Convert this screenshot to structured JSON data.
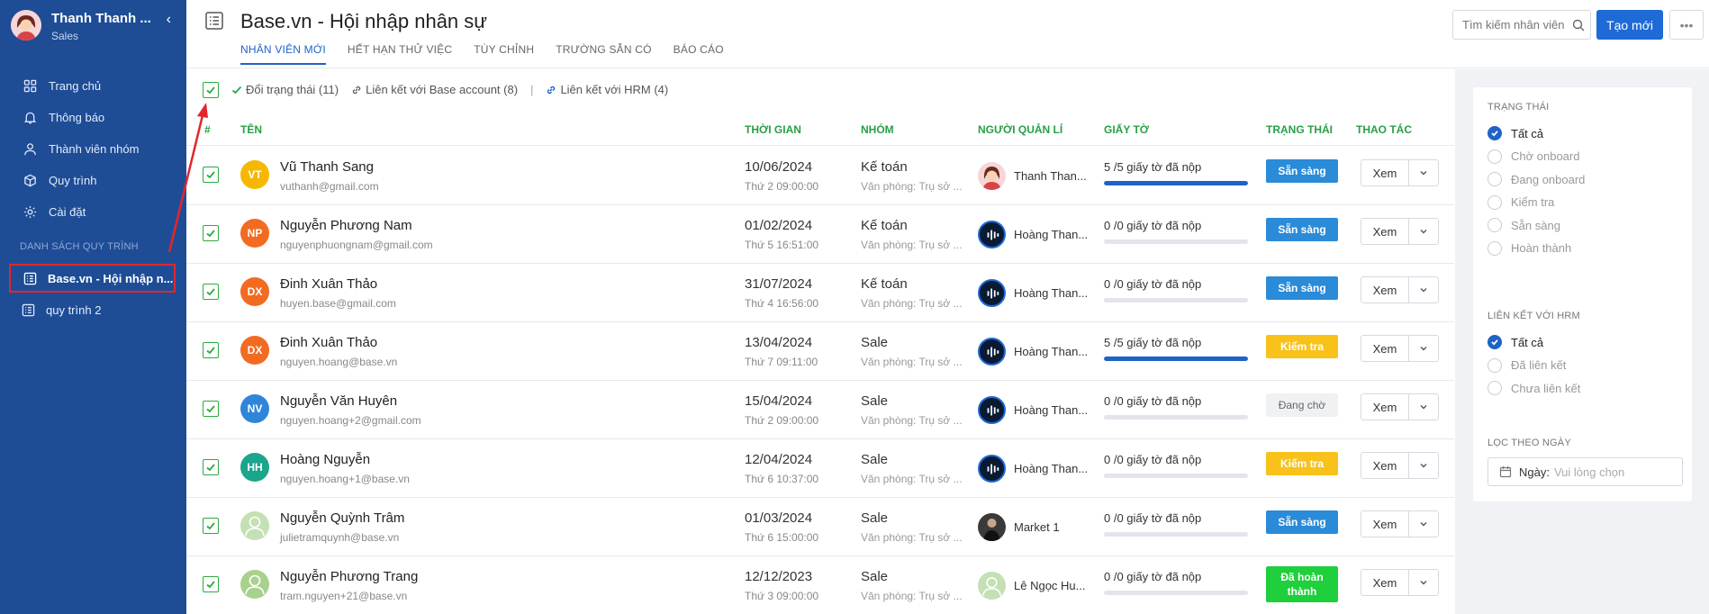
{
  "user": {
    "name": "Thanh Thanh ...",
    "role": "Sales"
  },
  "nav": [
    {
      "label": "Trang chủ",
      "icon": "grid-icon"
    },
    {
      "label": "Thông báo",
      "icon": "bell-icon"
    },
    {
      "label": "Thành viên nhóm",
      "icon": "user-icon"
    },
    {
      "label": "Quy trình",
      "icon": "box-icon"
    },
    {
      "label": "Cài đặt",
      "icon": "gear-icon"
    }
  ],
  "process_section": "DANH SÁCH QUY TRÌNH",
  "processes": [
    "Base.vn - Hội nhập n...",
    "quy trình 2"
  ],
  "header": {
    "title": "Base.vn - Hội nhập nhân sự",
    "tabs": [
      "NHÂN VIÊN MỚI",
      "HẾT HẠN THỬ VIỆC",
      "TÙY CHỈNH",
      "TRƯỜNG SẴN CÓ",
      "BÁO CÁO"
    ],
    "search_placeholder": "Tìm kiếm nhân viên",
    "new_label": "Tạo mới",
    "more_label": "•••"
  },
  "toolbar": {
    "change_status": "Đổi trạng thái (11)",
    "link_base": "Liên kết với Base account (8)",
    "sep": "|",
    "link_hrm": "Liên kết với HRM (4)"
  },
  "columns": {
    "index": "#",
    "name": "TÊN",
    "time": "THỜI GIAN",
    "group": "NHÓM",
    "manager": "NGƯỜI QUẢN LÍ",
    "docs": "GIẤY TỜ",
    "status": "TRẠNG THÁI",
    "action": "THAO TÁC"
  },
  "rows": [
    {
      "initials": "VT",
      "color": "#f5b800",
      "name": "Vũ Thanh Sang",
      "email": "vuthanh@gmail.com",
      "date": "10/06/2024",
      "time": "Thứ 2 09:00:00",
      "group": "Kế toán",
      "office": "Văn phòng: Trụ sở ...",
      "manager": "Thanh Than...",
      "manager_avatar": "woman",
      "docs": "5 /5 giấy tờ đã nộp",
      "progress": 1.0,
      "status": "Sẵn sàng",
      "status_type": "ready",
      "view": "Xem"
    },
    {
      "initials": "NP",
      "color": "#f26b21",
      "name": "Nguyễn Phương Nam",
      "email": "nguyenphuongnam@gmail.com",
      "date": "01/02/2024",
      "time": "Thứ 5 16:51:00",
      "group": "Kế toán",
      "office": "Văn phòng: Trụ sở ...",
      "manager": "Hoàng Than...",
      "manager_avatar": "wave",
      "docs": "0 /0 giấy tờ đã nộp",
      "progress": 0,
      "status": "Sẵn sàng",
      "status_type": "ready",
      "view": "Xem"
    },
    {
      "initials": "DX",
      "color": "#f26b21",
      "name": "Đinh Xuân Thảo",
      "email": "huyen.base@gmail.com",
      "date": "31/07/2024",
      "time": "Thứ 4 16:56:00",
      "group": "Kế toán",
      "office": "Văn phòng: Trụ sở ...",
      "manager": "Hoàng Than...",
      "manager_avatar": "wave",
      "docs": "0 /0 giấy tờ đã nộp",
      "progress": 0,
      "status": "Sẵn sàng",
      "status_type": "ready",
      "view": "Xem"
    },
    {
      "initials": "DX",
      "color": "#f26b21",
      "name": "Đinh Xuân Thảo",
      "email": "nguyen.hoang@base.vn",
      "date": "13/04/2024",
      "time": "Thứ 7 09:11:00",
      "group": "Sale",
      "office": "Văn phòng: Trụ sở ...",
      "manager": "Hoàng Than...",
      "manager_avatar": "wave",
      "docs": "5 /5 giấy tờ đã nộp",
      "progress": 1.0,
      "status": "Kiểm tra",
      "status_type": "check",
      "view": "Xem"
    },
    {
      "initials": "NV",
      "color": "#2f86d8",
      "name": "Nguyễn Văn Huyên",
      "email": "nguyen.hoang+2@gmail.com",
      "date": "15/04/2024",
      "time": "Thứ 2 09:00:00",
      "group": "Sale",
      "office": "Văn phòng: Trụ sở ...",
      "manager": "Hoàng Than...",
      "manager_avatar": "wave",
      "docs": "0 /0 giấy tờ đã nộp",
      "progress": 0,
      "status": "Đang chờ",
      "status_type": "wait",
      "view": "Xem"
    },
    {
      "initials": "HH",
      "color": "#1aa58c",
      "name": "Hoàng Nguyễn",
      "email": "nguyen.hoang+1@base.vn",
      "date": "12/04/2024",
      "time": "Thứ 6 10:37:00",
      "group": "Sale",
      "office": "Văn phòng: Trụ sở ...",
      "manager": "Hoàng Than...",
      "manager_avatar": "wave",
      "docs": "0 /0 giấy tờ đã nộp",
      "progress": 0,
      "status": "Kiểm tra",
      "status_type": "check",
      "view": "Xem"
    },
    {
      "initials": "",
      "color": "#c5e0b4",
      "name": "Nguyễn Quỳnh Trâm",
      "email": "julietramquynh@base.vn",
      "date": "01/03/2024",
      "time": "Thứ 6 15:00:00",
      "group": "Sale",
      "office": "Văn phòng: Trụ sở ...",
      "manager": "Market 1",
      "manager_avatar": "photo",
      "docs": "0 /0 giấy tờ đã nộp",
      "progress": 0,
      "status": "Sẵn sàng",
      "status_type": "ready",
      "view": "Xem"
    },
    {
      "initials": "",
      "color": "#a9d18e",
      "name": "Nguyễn Phương Trang",
      "email": "tram.nguyen+21@base.vn",
      "date": "12/12/2023",
      "time": "Thứ 3 09:00:00",
      "group": "Sale",
      "office": "Văn phòng: Trụ sở ...",
      "manager": "Lê Ngọc Hu...",
      "manager_avatar": "placeholder",
      "docs": "0 /0 giấy tờ đã nộp",
      "progress": 0,
      "status": "Đã hoàn thành",
      "status_type": "done",
      "view": "Xem"
    }
  ],
  "filters": {
    "status_title": "TRẠNG THÁI",
    "status_options": [
      "Tất cả",
      "Chờ onboard",
      "Đang onboard",
      "Kiểm tra",
      "Sẵn sàng",
      "Hoàn thành"
    ],
    "status_selected": 0,
    "hrm_title": "LIÊN KẾT VỚI HRM",
    "hrm_options": [
      "Tất cả",
      "Đã liên kết",
      "Chưa liên kết"
    ],
    "hrm_selected": 0,
    "date_title": "LỌC THEO NGÀY",
    "date_label": "Ngày:",
    "date_placeholder": "Vui lòng chọn"
  },
  "colors": {
    "sidebar": "#1e4d96",
    "accent": "#1e63c7",
    "green": "#27a046",
    "highlight": "#e2262c"
  }
}
